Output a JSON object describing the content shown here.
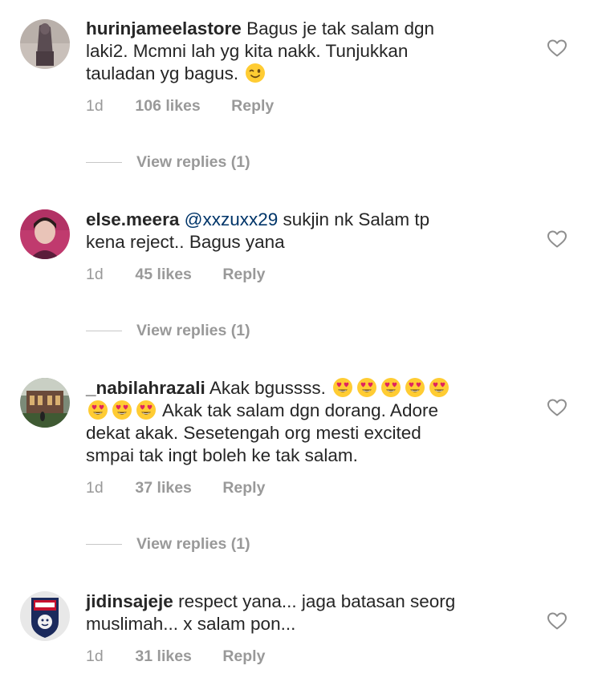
{
  "comments": [
    {
      "username": "hurinjameelastore",
      "mention": "",
      "line1": "Bagus je tak salam dgn",
      "line2": "laki2. Mcmni lah yg kita nakk. Tunjukkan",
      "line3": "tauladan yg bagus.",
      "emoji": "winking-face",
      "time": "1d",
      "likes": "106 likes",
      "reply": "Reply",
      "view_replies": "View replies (1)"
    },
    {
      "username": "else.meera",
      "mention": "@xxzuxx29",
      "line1": "sukjin nk Salam tp",
      "line2": "kena reject.. Bagus yana",
      "time": "1d",
      "likes": "45 likes",
      "reply": "Reply",
      "view_replies": "View replies (1)"
    },
    {
      "username": "_nabilahrazali",
      "line1": "Akak bgussss.",
      "line2": "Akak tak salam dgn dorang. Adore",
      "line3": "dekat akak. Sesetengah org mesti excited",
      "line4": "smpai tak ingt boleh ke tak salam.",
      "emoji": "heart-eyes-face",
      "time": "1d",
      "likes": "37 likes",
      "reply": "Reply",
      "view_replies": "View replies (1)"
    },
    {
      "username": "jidinsajeje",
      "line1": "respect yana... jaga batasan seorg",
      "line2": "muslimah... x salam pon...",
      "time": "1d",
      "likes": "31 likes",
      "reply": "Reply"
    }
  ],
  "colors": {
    "text": "#262626",
    "meta": "#999999",
    "mention": "#003569",
    "divider": "#c7c7c7"
  },
  "icons": [
    "heart-outline-icon",
    "winking-face-emoji",
    "heart-eyes-emoji"
  ]
}
